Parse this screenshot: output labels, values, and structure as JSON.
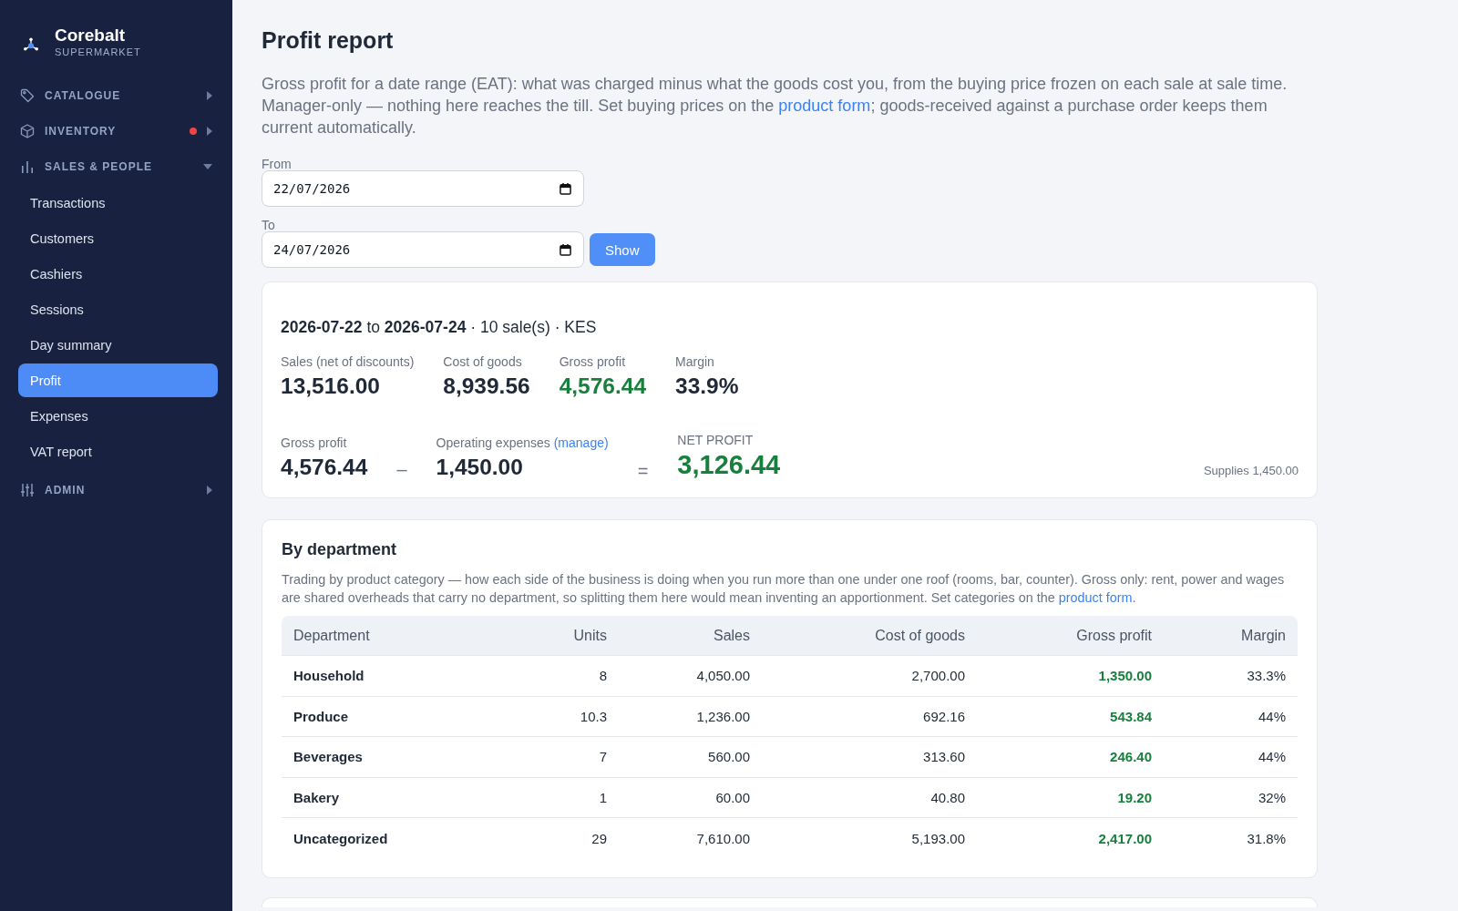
{
  "sidebar": {
    "brand": {
      "name": "Corebalt",
      "subtitle": "SUPERMARKET"
    },
    "sections": [
      {
        "label": "CATALOGUE",
        "expanded": false,
        "notification": false
      },
      {
        "label": "INVENTORY",
        "expanded": false,
        "notification": true
      },
      {
        "label": "SALES & PEOPLE",
        "expanded": true,
        "notification": false,
        "items": [
          {
            "label": "Transactions",
            "selected": false
          },
          {
            "label": "Customers",
            "selected": false
          },
          {
            "label": "Cashiers",
            "selected": false
          },
          {
            "label": "Sessions",
            "selected": false
          },
          {
            "label": "Day summary",
            "selected": false
          },
          {
            "label": "Profit",
            "selected": true
          },
          {
            "label": "Expenses",
            "selected": false
          },
          {
            "label": "VAT report",
            "selected": false
          }
        ]
      },
      {
        "label": "ADMIN",
        "expanded": false,
        "notification": false
      }
    ]
  },
  "page": {
    "title": "Profit report",
    "intro": [
      {
        "kind": "text",
        "text": "Gross profit for a date range (EAT): what was charged minus what the goods cost you, from the buying price frozen on each sale at sale time. Manager-only — nothing here reaches the till. Set buying prices on the "
      },
      {
        "kind": "link",
        "text": "product form"
      },
      {
        "kind": "text",
        "text": "; goods-received against a purchase order keeps them current automatically."
      }
    ],
    "filters": [
      {
        "label": "From",
        "value": "22/07/2026"
      },
      {
        "label": "To",
        "value": "24/07/2026"
      }
    ],
    "show_button": "Show",
    "summary": {
      "range": "**2026-07-22** to **2026-07-24** · 10 sale(s) · KES",
      "stats": [
        {
          "label": "Sales (net of discounts)",
          "value": "13,516.00",
          "kind": "amount"
        },
        {
          "label": "Cost of goods",
          "value": "8,939.56",
          "kind": "amount"
        },
        {
          "label": "Gross profit",
          "value": "4,576.44",
          "kind": "profit"
        },
        {
          "label": "Margin",
          "value": "33.9%",
          "kind": "amount"
        }
      ],
      "gross": {
        "label": "Gross profit",
        "value": "4,576.44"
      },
      "minus": "–",
      "expenses": {
        "label": "Operating expenses",
        "link": "(manage)",
        "value": "1,450.00"
      },
      "equals": "=",
      "net": {
        "label": "NET PROFIT",
        "value": "3,126.44"
      },
      "breakdown": "Supplies 1,450.00"
    },
    "departments": {
      "title": "By department",
      "description": [
        {
          "kind": "text",
          "text": "Trading by product category — how each side of the business is doing when you run more than one under one roof (rooms, bar, counter). Gross only: rent, power and wages are shared overheads that carry no department, so splitting them here would mean inventing an apportionment. Set categories on the "
        },
        {
          "kind": "link",
          "text": "product form"
        },
        {
          "kind": "text",
          "text": "."
        }
      ],
      "table": {
        "columns": [
          {
            "label": "Department",
            "kind": "name"
          },
          {
            "label": "Units",
            "kind": "number"
          },
          {
            "label": "Sales",
            "kind": "number"
          },
          {
            "label": "Cost of goods",
            "kind": "number"
          },
          {
            "label": "Gross profit",
            "kind": "profit"
          },
          {
            "label": "Margin",
            "kind": "number"
          }
        ],
        "rows": [
          [
            "Household",
            "8",
            "4,050.00",
            "2,700.00",
            "1,350.00",
            "33.3%"
          ],
          [
            "Produce",
            "10.3",
            "1,236.00",
            "692.16",
            "543.84",
            "44%"
          ],
          [
            "Beverages",
            "7",
            "560.00",
            "313.60",
            "246.40",
            "44%"
          ],
          [
            "Bakery",
            "1",
            "60.00",
            "40.80",
            "19.20",
            "32%"
          ],
          [
            "Uncategorized",
            "29",
            "7,610.00",
            "5,193.00",
            "2,417.00",
            "31.8%"
          ]
        ]
      }
    }
  }
}
